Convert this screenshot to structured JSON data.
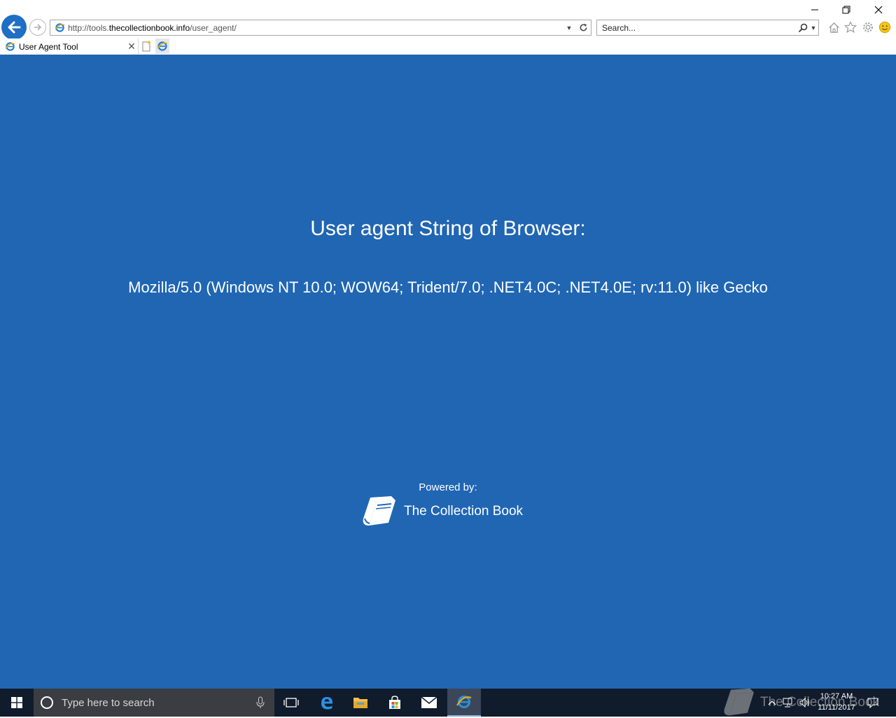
{
  "browser": {
    "url_prefix": "http://tools.",
    "url_domain": "thecollectionbook.info",
    "url_path": "/user_agent/",
    "search_placeholder": "Search...",
    "tab_title": "User Agent Tool"
  },
  "page": {
    "heading": "User agent String of Browser:",
    "user_agent": "Mozilla/5.0 (Windows NT 10.0; WOW64; Trident/7.0; .NET4.0C; .NET4.0E; rv:11.0) like Gecko",
    "powered_by": "Powered by:",
    "brand_name": "The Collection Book",
    "background_color": "#2066b3"
  },
  "taskbar": {
    "search_placeholder": "Type here to search",
    "time": "10:27 AM",
    "date": "11/11/2017",
    "watermark": "The Collection Book"
  },
  "icons": [
    "back-icon",
    "forward-icon",
    "ie-favicon-icon",
    "refresh-icon",
    "search-icon",
    "home-icon",
    "favorites-star-icon",
    "gear-icon",
    "smiley-feedback-icon",
    "minimize-icon",
    "restore-icon",
    "close-icon",
    "new-tab-icon",
    "book-logo-icon",
    "windows-start-icon",
    "cortana-icon",
    "mic-icon",
    "task-view-icon",
    "edge-icon",
    "file-explorer-icon",
    "store-icon",
    "mail-icon",
    "internet-explorer-icon",
    "chevron-up-icon",
    "network-icon",
    "volume-icon",
    "notifications-icon"
  ]
}
